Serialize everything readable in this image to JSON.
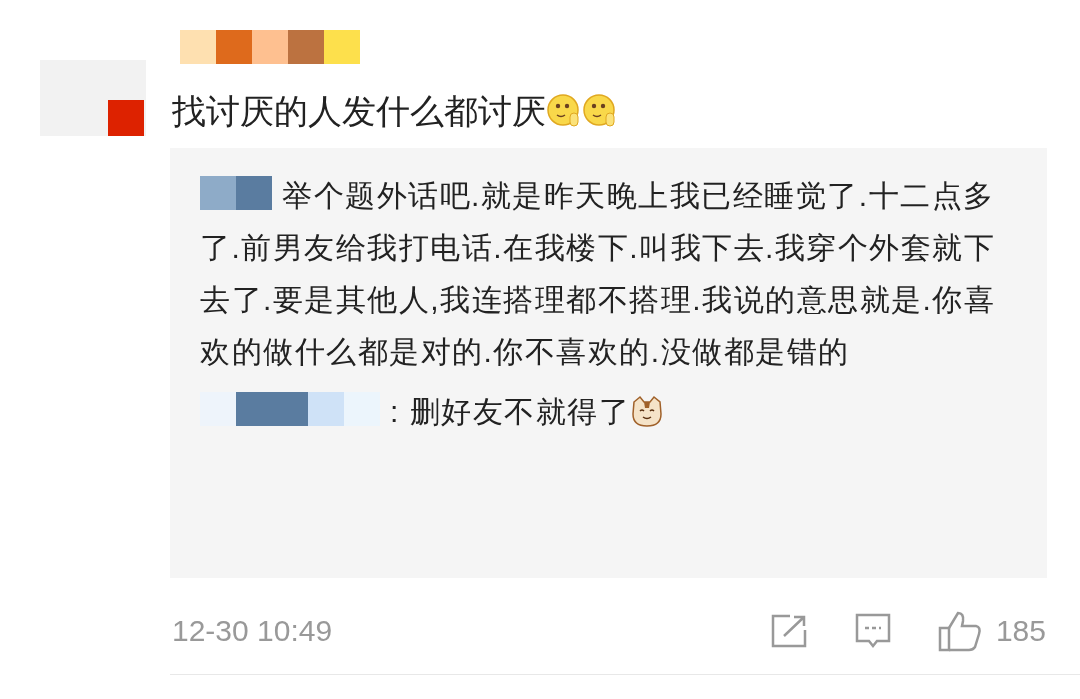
{
  "comment": {
    "text": "找讨厌的人发什么都讨厌",
    "emojis": [
      {
        "kind": "shy"
      },
      {
        "kind": "shy"
      }
    ]
  },
  "replies": [
    {
      "text": "举个题外话吧.就是昨天晚上我已经睡觉了.十二点多了.前男友给我打电话.在我楼下.叫我下去.我穿个外套就下去了.要是其他人,我连搭理都不搭理.我说的意思就是.你喜欢的做什么都是对的.你不喜欢的.没做都是错的"
    },
    {
      "text": ": 删好友不就得了",
      "emojis": [
        {
          "kind": "cat"
        }
      ]
    }
  ],
  "footer": {
    "time": "12-30 10:49",
    "likes": "185"
  }
}
